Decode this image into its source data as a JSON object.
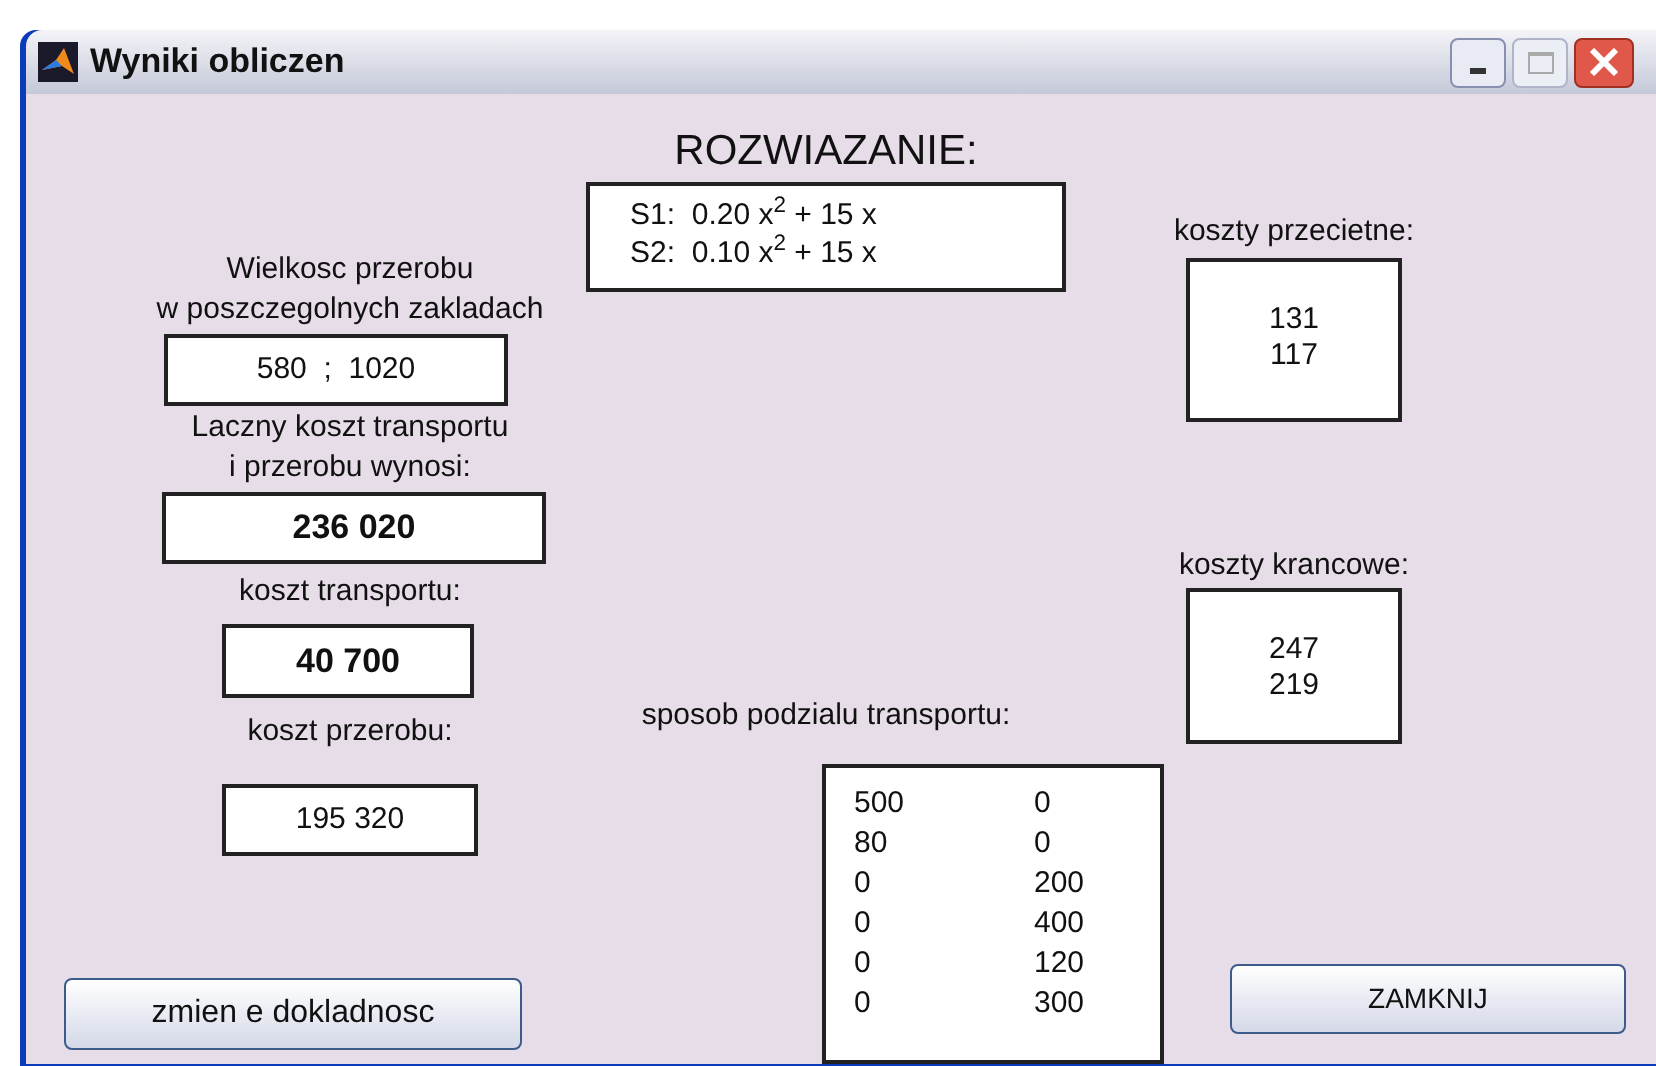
{
  "window": {
    "title": "Wyniki obliczen"
  },
  "heading": "ROZWIAZANIE:",
  "equations": [
    "S1:  0.20 x$^{2}$ + 15 x",
    "S2:  0.10 x$^{2}$ + 15 x"
  ],
  "left_fields": [
    {
      "label": [
        "Wielkosc przerobu",
        "w poszczegolnych zakladach"
      ],
      "value": "580  ;  1020",
      "bold": false
    },
    {
      "label": [
        "Laczny koszt transportu",
        "i przerobu wynosi:"
      ],
      "value": "236 020",
      "bold": true
    },
    {
      "label": [
        "koszt transportu:"
      ],
      "value": "40 700",
      "bold": true
    },
    {
      "label": [
        "koszt przerobu:"
      ],
      "value": "195 320",
      "bold": false
    }
  ],
  "average_costs": {
    "label": "koszty przecietne:",
    "values": [
      "131",
      "117"
    ]
  },
  "marginal_costs": {
    "label": "koszty krancowe:",
    "values": [
      "247",
      "219"
    ]
  },
  "transport_split": {
    "label": "sposob podzialu transportu:",
    "rows": [
      [
        "500",
        "0"
      ],
      [
        "80",
        "0"
      ],
      [
        "0",
        "200"
      ],
      [
        "0",
        "400"
      ],
      [
        "0",
        "120"
      ],
      [
        "0",
        "300"
      ]
    ]
  },
  "precision_button": "zmien e dokladnosc",
  "close_button": "ZAMKNIJ"
}
